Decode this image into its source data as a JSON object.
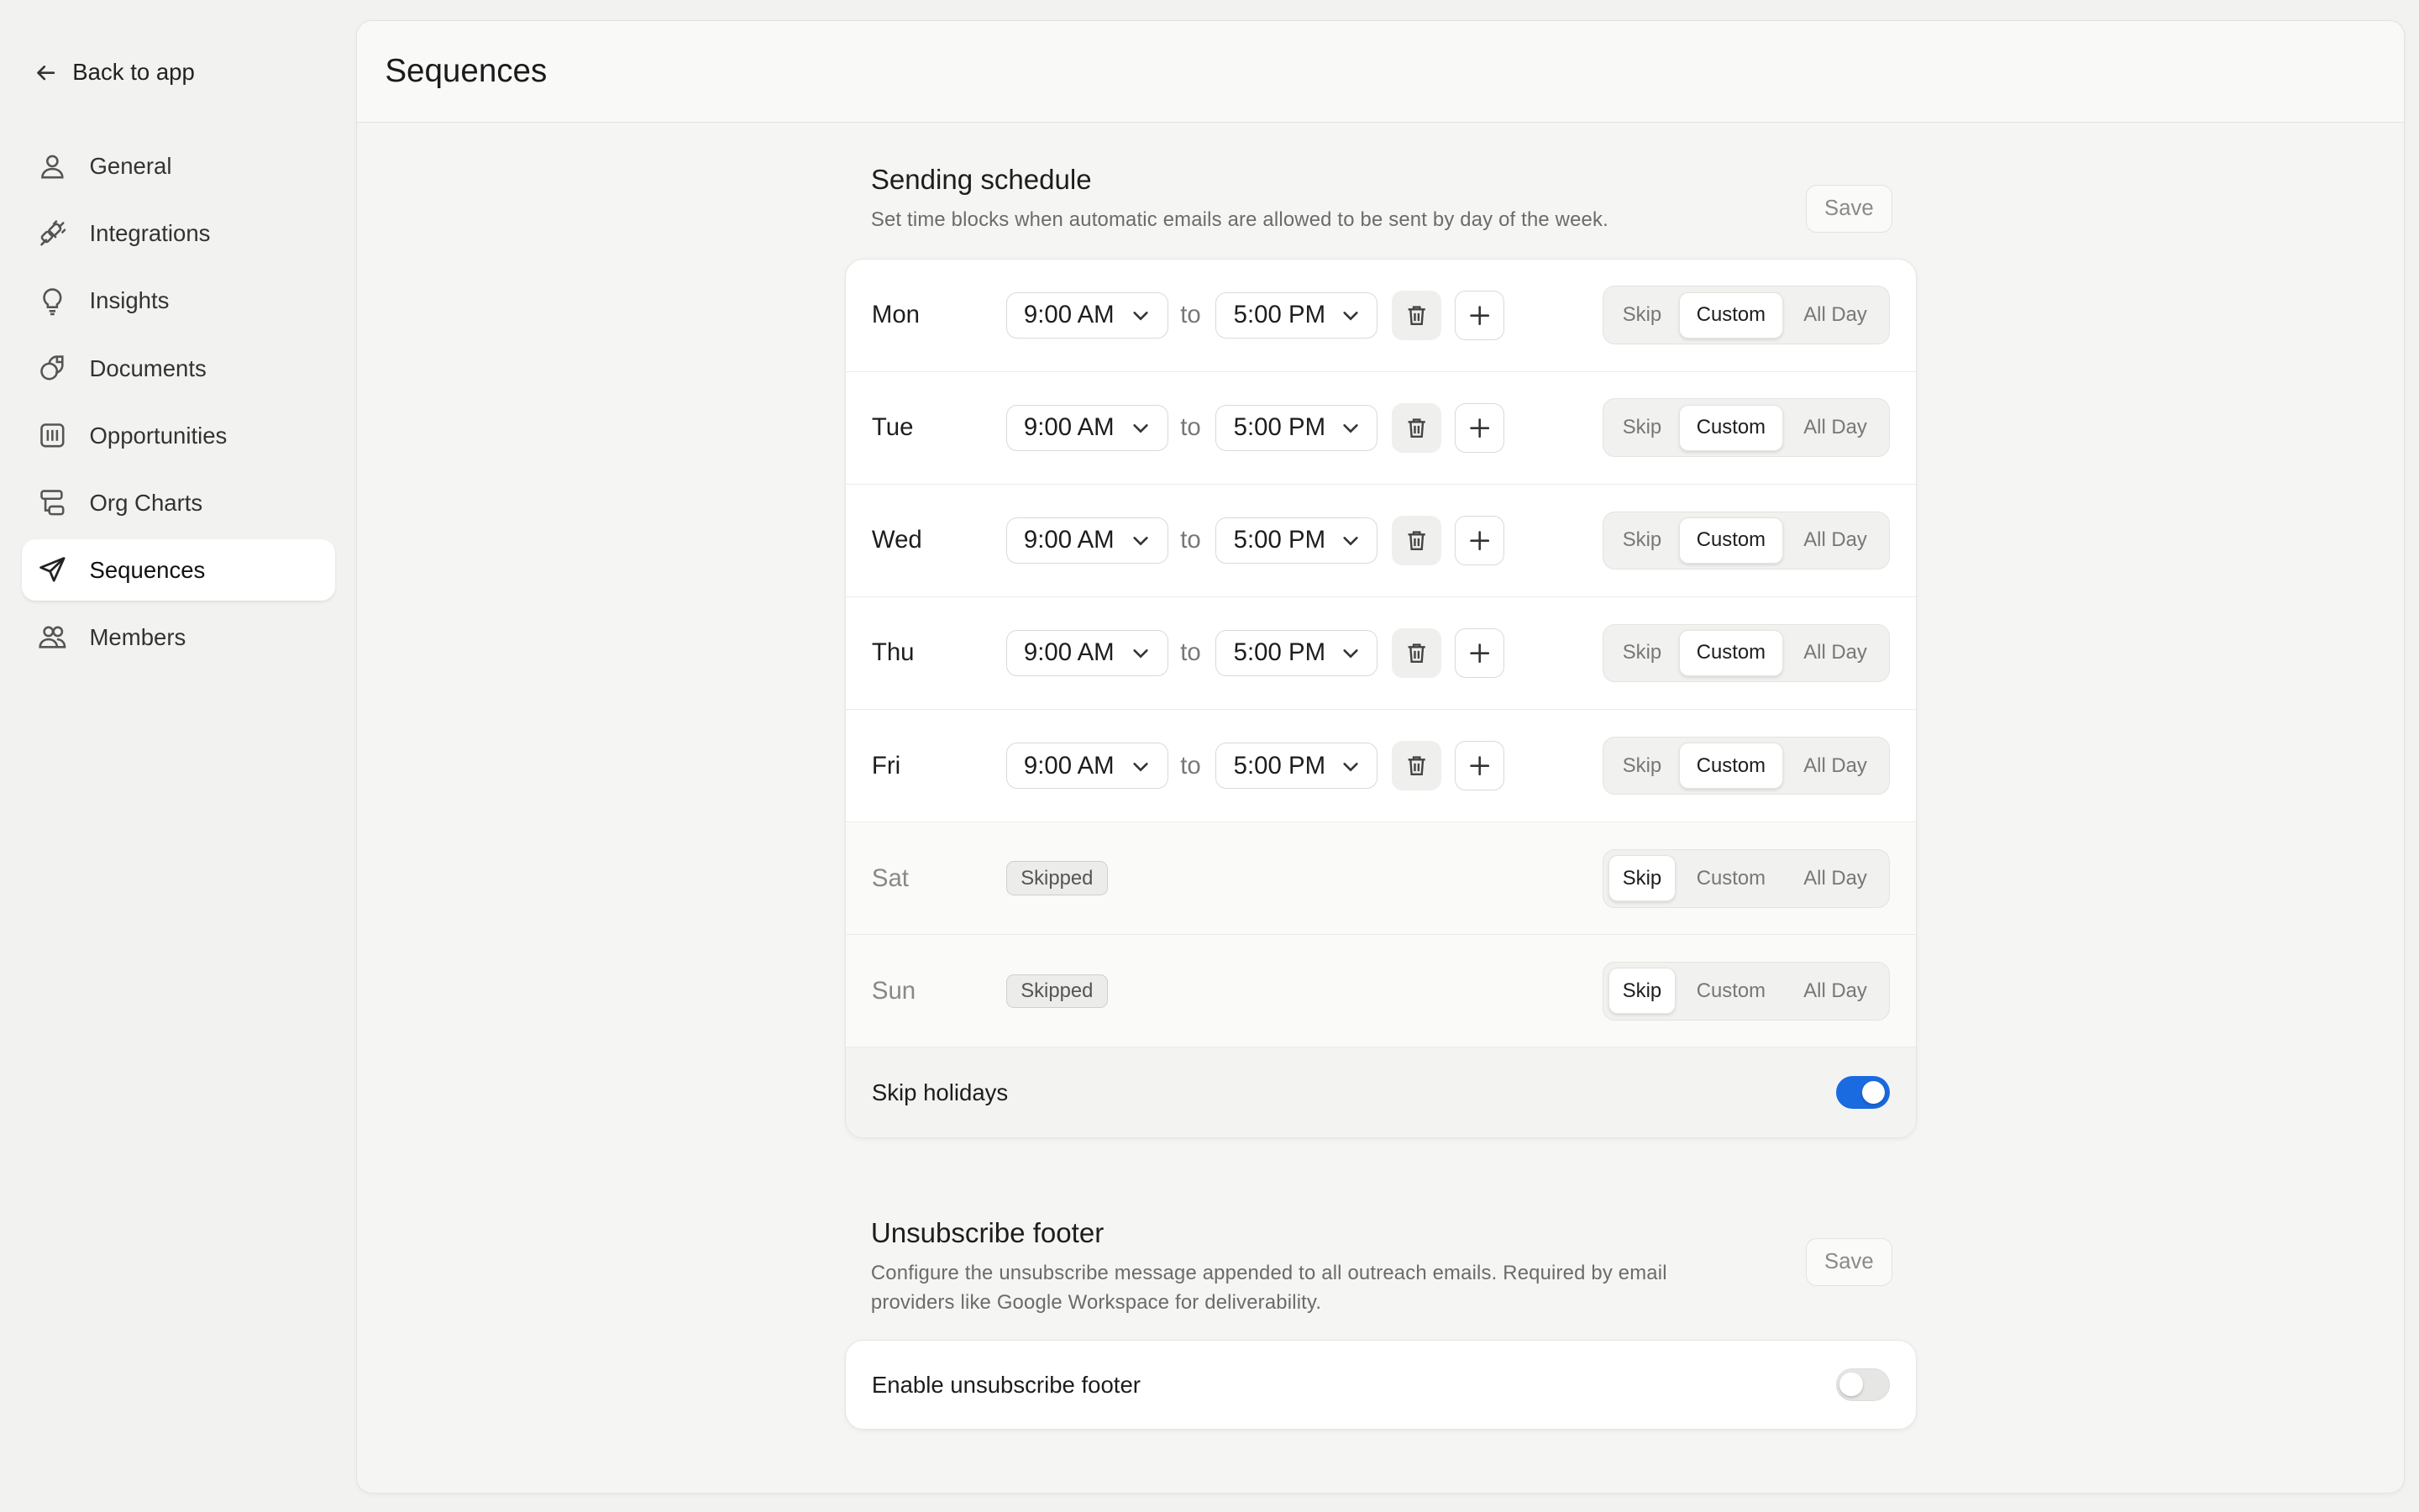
{
  "sidebar": {
    "back_label": "Back to app",
    "items": [
      {
        "label": "General",
        "icon": "user-icon"
      },
      {
        "label": "Integrations",
        "icon": "plug-icon"
      },
      {
        "label": "Insights",
        "icon": "lightbulb-icon"
      },
      {
        "label": "Documents",
        "icon": "documents-icon"
      },
      {
        "label": "Opportunities",
        "icon": "opportunities-icon"
      },
      {
        "label": "Org Charts",
        "icon": "org-chart-icon"
      },
      {
        "label": "Sequences",
        "icon": "send-icon",
        "active": true
      },
      {
        "label": "Members",
        "icon": "users-icon"
      }
    ]
  },
  "header": {
    "title": "Sequences"
  },
  "schedule": {
    "title": "Sending schedule",
    "description": "Set time blocks when automatic emails are allowed to be sent by day of the week.",
    "save_label": "Save",
    "to_label": "to",
    "skipped_label": "Skipped",
    "mode_options": [
      "Skip",
      "Custom",
      "All Day"
    ],
    "days": [
      {
        "name": "Mon",
        "mode": "Custom",
        "start": "9:00 AM",
        "end": "5:00 PM"
      },
      {
        "name": "Tue",
        "mode": "Custom",
        "start": "9:00 AM",
        "end": "5:00 PM"
      },
      {
        "name": "Wed",
        "mode": "Custom",
        "start": "9:00 AM",
        "end": "5:00 PM"
      },
      {
        "name": "Thu",
        "mode": "Custom",
        "start": "9:00 AM",
        "end": "5:00 PM"
      },
      {
        "name": "Fri",
        "mode": "Custom",
        "start": "9:00 AM",
        "end": "5:00 PM"
      },
      {
        "name": "Sat",
        "mode": "Skip"
      },
      {
        "name": "Sun",
        "mode": "Skip"
      }
    ],
    "skip_holidays": {
      "label": "Skip holidays",
      "enabled": true
    }
  },
  "unsubscribe": {
    "title": "Unsubscribe footer",
    "description": "Configure the unsubscribe message appended to all outreach emails. Required by email providers like Google Workspace for deliverability.",
    "save_label": "Save",
    "enable": {
      "label": "Enable unsubscribe footer",
      "enabled": false
    }
  },
  "colors": {
    "accent": "#1a6ae0",
    "background": "#f2f2f0"
  }
}
